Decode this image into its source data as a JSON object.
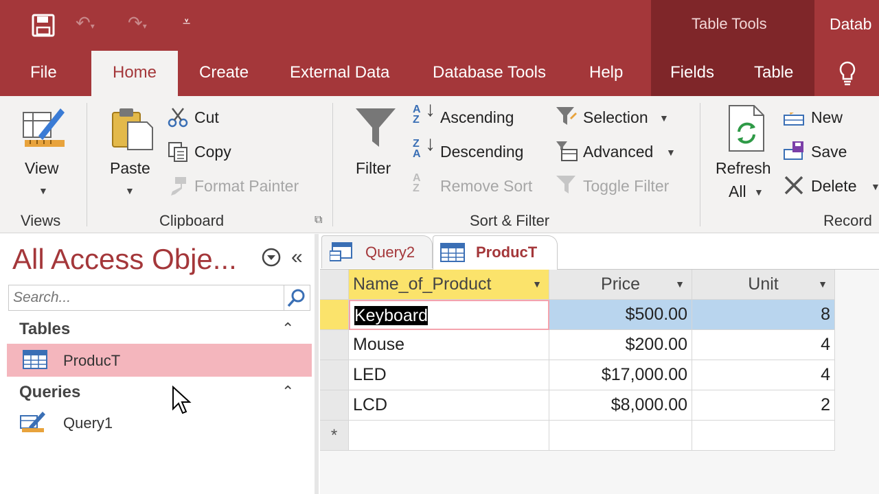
{
  "title_bar": {
    "context_tab_group": "Table Tools",
    "app_title_partial": "Datab"
  },
  "ribbon_tabs": [
    "File",
    "Home",
    "Create",
    "External Data",
    "Database Tools",
    "Help",
    "Fields",
    "Table"
  ],
  "ribbon": {
    "views": {
      "view": "View",
      "group": "Views"
    },
    "clipboard": {
      "paste": "Paste",
      "cut": "Cut",
      "copy": "Copy",
      "format_painter": "Format Painter",
      "group": "Clipboard"
    },
    "sort_filter": {
      "filter": "Filter",
      "ascending": "Ascending",
      "descending": "Descending",
      "remove_sort": "Remove Sort",
      "selection": "Selection",
      "advanced": "Advanced",
      "toggle_filter": "Toggle Filter",
      "group": "Sort & Filter"
    },
    "records": {
      "refresh": "Refresh",
      "refresh_all": "All",
      "new": "New",
      "save": "Save",
      "delete": "Delete",
      "group": "Record"
    }
  },
  "nav_pane": {
    "title": "All Access Obje...",
    "search_placeholder": "Search...",
    "sections": [
      {
        "name": "Tables",
        "items": [
          "ProducT"
        ]
      },
      {
        "name": "Queries",
        "items": [
          "Query1"
        ]
      }
    ]
  },
  "doc_tabs": [
    "Query2",
    "ProducT"
  ],
  "table": {
    "columns": [
      "Name_of_Product",
      "Price",
      "Unit"
    ],
    "rows": [
      [
        "Keyboard",
        "$500.00",
        "8"
      ],
      [
        "Mouse",
        "$200.00",
        "4"
      ],
      [
        "LED",
        "$17,000.00",
        "4"
      ],
      [
        "LCD",
        "$8,000.00",
        "2"
      ]
    ],
    "new_row_marker": "*"
  },
  "colors": {
    "accent": "#a4373a",
    "context": "#7f2629",
    "selection": "#b9d5ee",
    "active_header": "#fbe36b"
  }
}
